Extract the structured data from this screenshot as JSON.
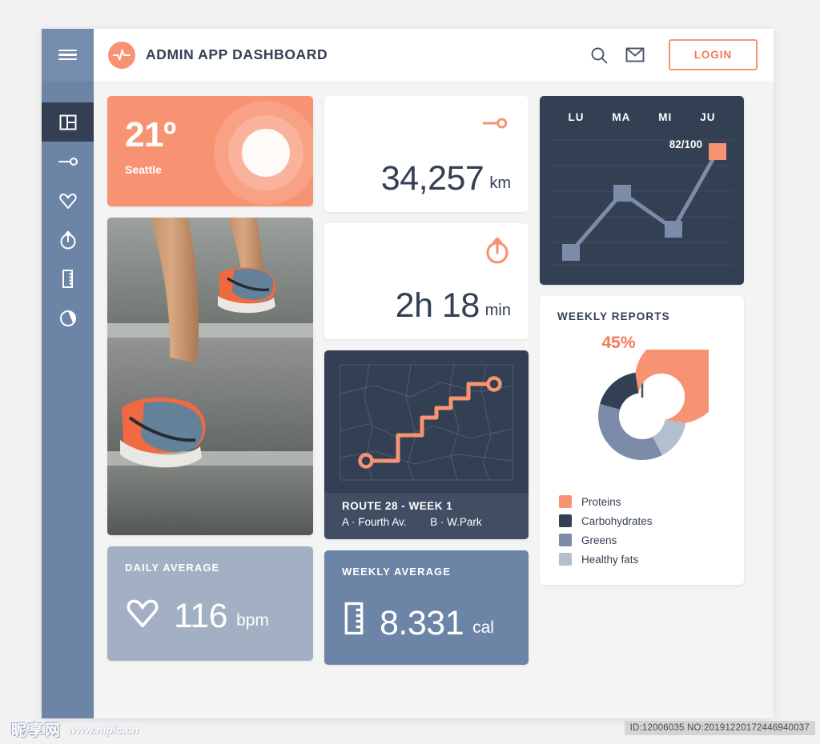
{
  "header": {
    "title": "ADMIN APP DASHBOARD",
    "logo_icon": "heartbeat-pulse-icon",
    "search_icon": "search-icon",
    "mail_icon": "mail-icon",
    "login_label": "LOGIN",
    "accent": "#f79372",
    "title_color": "#333f53"
  },
  "sidebar": {
    "menu_icon": "hamburger-menu-icon",
    "background": "#6c84a6",
    "active_background": "#343f54",
    "items": [
      {
        "icon": "dashboard-layout-icon",
        "active": true
      },
      {
        "icon": "distance-pin-icon",
        "active": false
      },
      {
        "icon": "heart-icon",
        "active": false
      },
      {
        "icon": "stopwatch-icon",
        "active": false
      },
      {
        "icon": "ruler-icon",
        "active": false
      },
      {
        "icon": "pie-chart-icon",
        "active": false
      }
    ]
  },
  "weather": {
    "temperature": "21º",
    "city": "Seattle",
    "background": "#f79372",
    "sun_icon": "sun-rings-icon"
  },
  "photo": {
    "alt": "runner-legs-on-stairs-photo"
  },
  "distance": {
    "icon": "distance-pin-icon",
    "value": "34,257",
    "unit": "km"
  },
  "duration": {
    "icon": "stopwatch-icon",
    "value": "2h 18",
    "unit": "min"
  },
  "route": {
    "title": "ROUTE 28 - WEEK 1",
    "point_a": "A · Fourth Av.",
    "point_b": "B · W.Park",
    "map_icon": "route-map-icon",
    "background": "#333f53",
    "route_color": "#f79372"
  },
  "daily_average": {
    "label": "DAILY AVERAGE",
    "icon": "heart-icon",
    "value": "116",
    "unit": "bpm",
    "background": "#a3b0c4"
  },
  "weekly_average": {
    "label": "WEEKLY AVERAGE",
    "icon": "ruler-icon",
    "value": "8.331",
    "unit": "cal",
    "background": "#6c84a6"
  },
  "reports": {
    "title": "WEEKLY REPORTS",
    "highlight_pct": "45%",
    "highlight_color": "#f2795a"
  },
  "watermark": {
    "site_cn": "昵享网",
    "site_url": "www.nipic.cn",
    "id_text": "ID:12006035 NO:20191220172446940037"
  },
  "chart_data": [
    {
      "type": "line",
      "title": "",
      "categories": [
        "LU",
        "MA",
        "MI",
        "JU"
      ],
      "values": [
        12,
        58,
        32,
        92
      ],
      "ylim": [
        0,
        100
      ],
      "annotation": "82/100",
      "annotation_index": 3,
      "line_color": "#7c8ca8",
      "marker_color": "#7c8ca8",
      "highlight_marker_color": "#f79372",
      "background": "#333f53",
      "grid": true,
      "gridlines": 6,
      "xlabel": "",
      "ylabel": ""
    },
    {
      "type": "pie",
      "title": "WEEKLY REPORTS",
      "labels": [
        "Proteins",
        "Carbohydrates",
        "Greens",
        "Healthy fats"
      ],
      "values": [
        45,
        23,
        22,
        10
      ],
      "colors": [
        "#f79372",
        "#333f53",
        "#7c8ca8",
        "#b3bece"
      ],
      "highlight_label": "45%",
      "legend": "bottom-left",
      "donut": true
    }
  ]
}
